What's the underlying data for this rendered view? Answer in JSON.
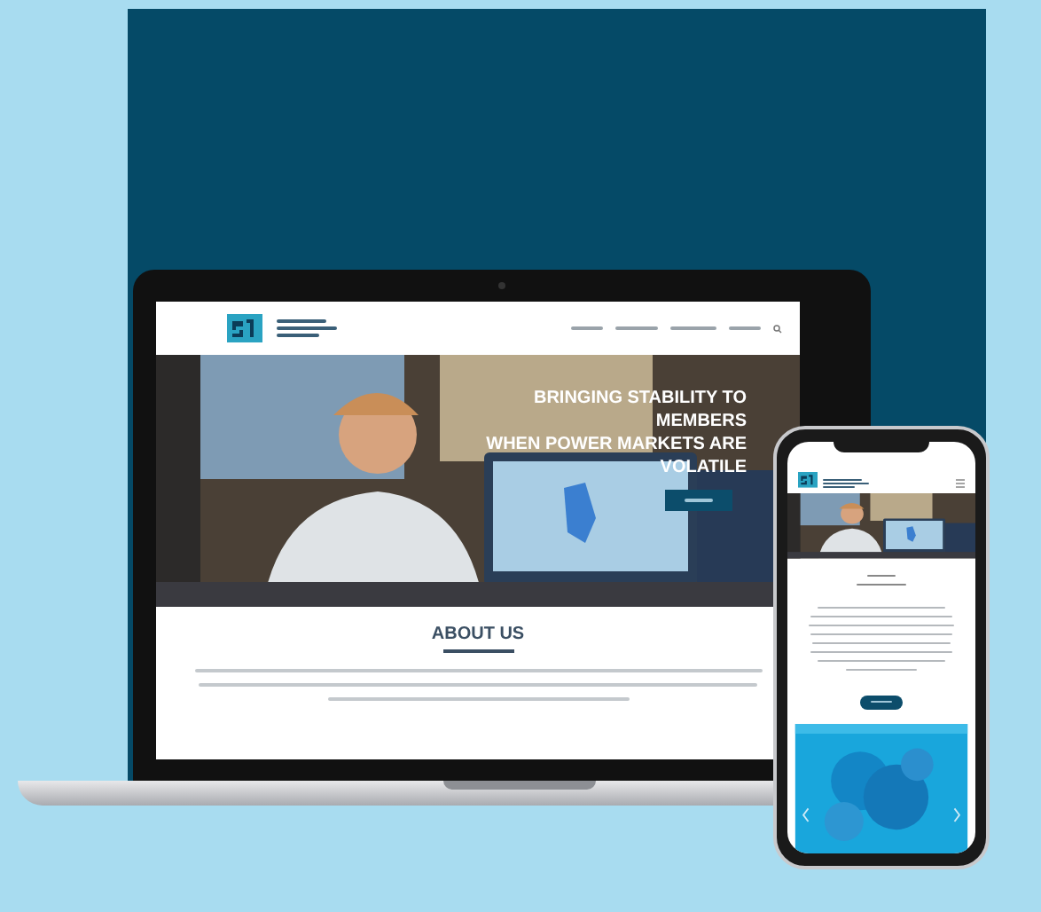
{
  "laptop_site": {
    "hero": {
      "headline_lines": [
        "BRINGING STABILITY TO",
        "MEMBERS",
        "WHEN POWER MARKETS ARE",
        "VOLATILE"
      ]
    },
    "about": {
      "heading": "ABOUT US"
    }
  }
}
